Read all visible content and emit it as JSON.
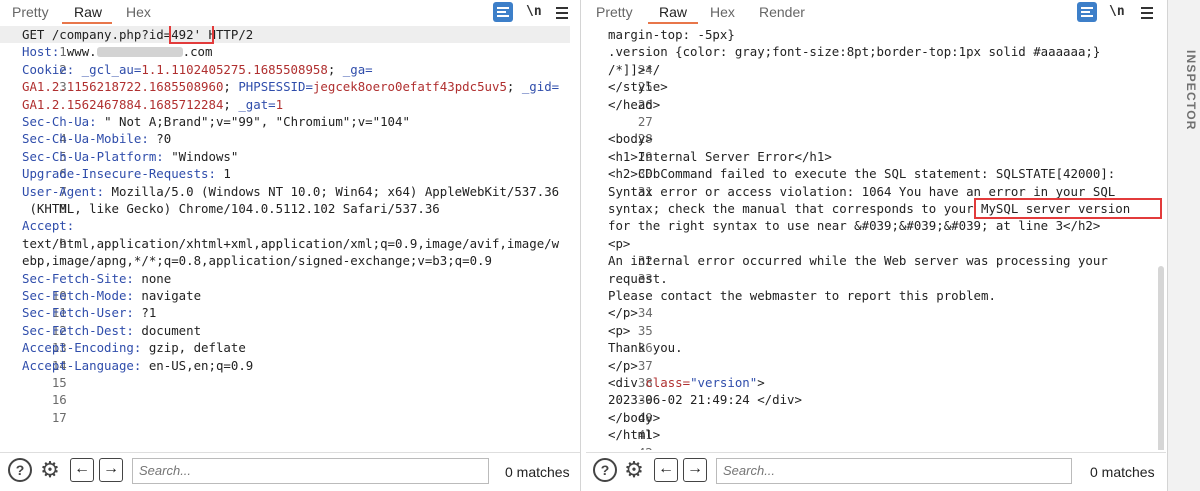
{
  "request": {
    "tabs": [
      {
        "label": "Pretty"
      },
      {
        "label": "Raw"
      },
      {
        "label": "Hex"
      }
    ],
    "newline_label": "\\n",
    "lines": [
      {
        "num": "1",
        "text": "GET /company.php?id="
      },
      {
        "num": "2",
        "text": ""
      },
      {
        "num": "3",
        "text": ""
      },
      {
        "num": "4",
        "text": ""
      },
      {
        "num": "5",
        "text": ""
      },
      {
        "num": "6",
        "text": ""
      },
      {
        "num": "7",
        "text": ""
      },
      {
        "num": "8",
        "text": ""
      },
      {
        "num": "9",
        "text": ""
      },
      {
        "num": "10",
        "text": ""
      },
      {
        "num": "11",
        "text": ""
      },
      {
        "num": "12",
        "text": ""
      },
      {
        "num": "13",
        "text": ""
      },
      {
        "num": "14",
        "text": ""
      },
      {
        "num": "15",
        "text": ""
      },
      {
        "num": "16",
        "text": ""
      },
      {
        "num": "17",
        "text": ""
      }
    ],
    "l1_payload": "492'",
    "l1_tail": " HTTP/2",
    "host_key": "Host:",
    "host_prefix": " www.",
    "host_suffix": ".com",
    "cookie_key": "Cookie:",
    "cookie_l1a": " _gcl_au=",
    "cookie_l1b": "1.1.1102405275.1685508958",
    "cookie_l1c": "; ",
    "cookie_l1d": "_ga=",
    "cookie_l2a": "GA1.2.1156218722.1685508960",
    "cookie_l2b": "; ",
    "cookie_l2c": "PHPSESSID=",
    "cookie_l2d": "jegcek8oero0efatf43pdc5uv5",
    "cookie_l2e": "; ",
    "cookie_l2f": "_gid=",
    "cookie_l3a": "GA1.2.1562467884.1685712284",
    "cookie_l3b": "; ",
    "cookie_l3c": "_gat=",
    "cookie_l3d": "1",
    "h4k": "Sec-Ch-Ua:",
    "h4v": " \" Not A;Brand\";v=\"99\", \"Chromium\";v=\"104\"",
    "h5k": "Sec-Ch-Ua-Mobile:",
    "h5v": " ?0",
    "h6k": "Sec-Ch-Ua-Platform:",
    "h6v": " \"Windows\"",
    "h7k": "Upgrade-Insecure-Requests:",
    "h7v": " 1",
    "h8k": "User-Agent:",
    "h8v": " Mozilla/5.0 (Windows NT 10.0; Win64; x64) AppleWebKit/537.36",
    "h8v2": " (KHTML, like Gecko) Chrome/104.0.5112.102 Safari/537.36",
    "h9k": "Accept:",
    "h9v1": "text/html,application/xhtml+xml,application/xml;q=0.9,image/avif,image/w",
    "h9v2": "ebp,image/apng,*/*;q=0.8,application/signed-exchange;v=b3;q=0.9",
    "h10k": "Sec-Fetch-Site:",
    "h10v": " none",
    "h11k": "Sec-Fetch-Mode:",
    "h11v": " navigate",
    "h12k": "Sec-Fetch-User:",
    "h12v": " ?1",
    "h13k": "Sec-Fetch-Dest:",
    "h13v": " document",
    "h14k": "Accept-Encoding:",
    "h14v": " gzip, deflate",
    "h15k": "Accept-Language:",
    "h15v": " en-US,en;q=0.9",
    "search_placeholder": "Search...",
    "matches": "0 matches"
  },
  "response": {
    "tabs": [
      {
        "label": "Pretty"
      },
      {
        "label": "Raw"
      },
      {
        "label": "Hex"
      },
      {
        "label": "Render"
      }
    ],
    "newline_label": "\\n",
    "top_fragment": "margin-top: -5px}",
    "l24": ".version {color: gray;font-size:8pt;border-top:1px solid #aaaaaa;}",
    "l25": "/*]]>*/",
    "l26": "</style>",
    "l27": "</head>",
    "l29": "<body>",
    "l30": "<h1>Internal Server Error</h1>",
    "l31a": "<h2>CDbCommand failed to execute the SQL statement: SQLSTATE[42000]:",
    "l31b": "Syntax error or access violation: 1064 You have an error in your SQL",
    "l31c": "syntax; check the manual that corresponds to your ",
    "l31c_highlight": "MySQL server version",
    "l31d": "for the right syntax to use near &#039;&#039;&#039; at line 3</h2>",
    "l32": "<p>",
    "l33a": "An internal error occurred while the Web server was processing your",
    "l33b": "request.",
    "l34": "Please contact the webmaster to report this problem.",
    "l35": "</p>",
    "l36": "<p>",
    "l37": "Thank you.",
    "l38": "</p>",
    "l39a": "<div ",
    "l39b": "class=",
    "l39c": "\"version\"",
    "l39d": ">",
    "l40": "2023-06-02 21:49:24 </div>",
    "l41": "</body>",
    "l42": "</html>",
    "nums": {
      "n24": "24",
      "n25": "25",
      "n26": "26",
      "n27": "27",
      "n28": "28",
      "n29": "29",
      "n30": "30",
      "n31": "31",
      "n32": "32",
      "n33": "33",
      "n34": "34",
      "n35": "35",
      "n36": "36",
      "n37": "37",
      "n38": "38",
      "n39": "39",
      "n40": "40",
      "n41": "41",
      "n42": "42"
    },
    "search_placeholder": "Search...",
    "matches": "0 matches"
  },
  "inspector": {
    "label": "INSPECTOR"
  },
  "icons": {
    "help": "?",
    "gear": "⚙",
    "back": "←",
    "forward": "→"
  },
  "colors": {
    "accent": "#e8764a",
    "highlight_box": "#e23b3b",
    "header_key": "#2f4dab",
    "cookie_value": "#b03030",
    "wrap_icon": "#3d7fc9"
  }
}
